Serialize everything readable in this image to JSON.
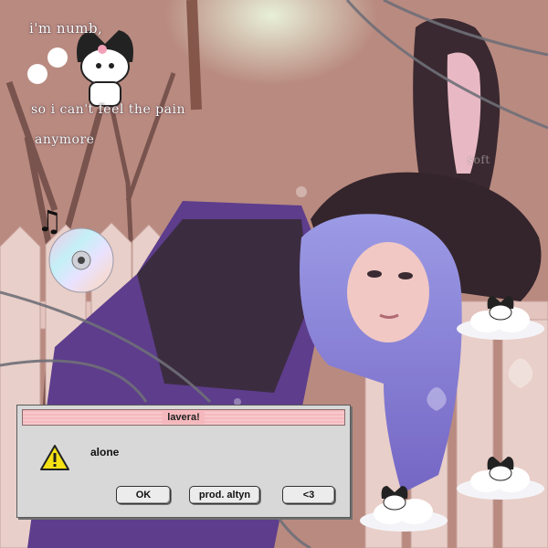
{
  "overlay_text": {
    "line1": "i'm numb,",
    "line2": "so i can't feel the pain",
    "line3": "anymore",
    "chains_label": "soft"
  },
  "dialog": {
    "title": "lavera!",
    "message": "alone",
    "icon": "warning-icon",
    "buttons": [
      {
        "label": "OK"
      },
      {
        "label": "prod. altyn"
      },
      {
        "label": "<3"
      }
    ]
  },
  "colors": {
    "titlebar_pink": "#f5b9bd",
    "dialog_gray": "#d8d8d8",
    "hair_purple": "#8d86d6",
    "hoodie_purple": "#5a3f8a"
  }
}
